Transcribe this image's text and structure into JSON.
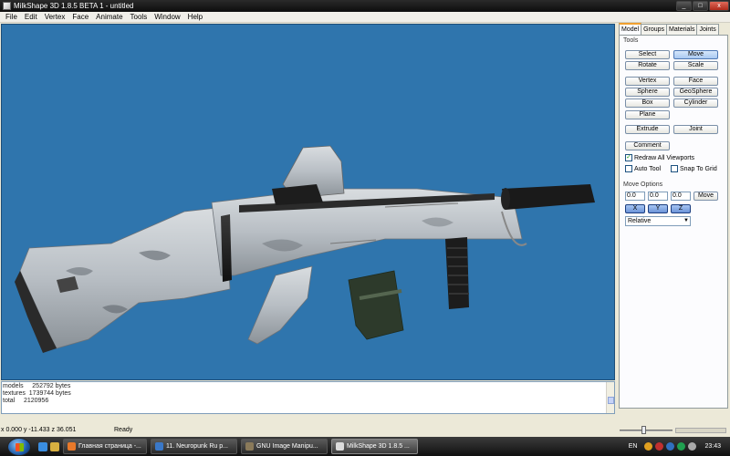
{
  "window": {
    "title": "MilkShape 3D 1.8.5 BETA 1 - untitled",
    "buttons": {
      "minimize": "_",
      "maximize": "□",
      "close": "x"
    }
  },
  "menu": [
    "File",
    "Edit",
    "Vertex",
    "Face",
    "Animate",
    "Tools",
    "Window",
    "Help"
  ],
  "viewport": {
    "background": "#2f75ad"
  },
  "panel": {
    "tabs": [
      "Model",
      "Groups",
      "Materials",
      "Joints"
    ],
    "active_tab": "Model",
    "tools_label": "Tools",
    "tool_buttons": [
      {
        "label": "Select",
        "selected": false
      },
      {
        "label": "Move",
        "selected": true
      },
      {
        "label": "Rotate",
        "selected": false
      },
      {
        "label": "Scale",
        "selected": false
      },
      {
        "label": "Vertex",
        "selected": false
      },
      {
        "label": "Face",
        "selected": false
      },
      {
        "label": "Sphere",
        "selected": false
      },
      {
        "label": "GeoSphere",
        "selected": false
      },
      {
        "label": "Box",
        "selected": false
      },
      {
        "label": "Cylinder",
        "selected": false
      },
      {
        "label": "Plane",
        "selected": false
      },
      {
        "label": "Extrude",
        "selected": false
      },
      {
        "label": "Joint",
        "selected": false
      }
    ],
    "comment_button": "Comment",
    "redraw_all_viewports": {
      "label": "Redraw All Viewports",
      "checked": true
    },
    "auto_tool": {
      "label": "Auto Tool",
      "checked": false
    },
    "snap_to_grid": {
      "label": "Snap To Grid",
      "checked": false
    },
    "move_options_label": "Move Options",
    "move_values": [
      "0.0",
      "0.0",
      "0.0"
    ],
    "move_button": "Move",
    "axis_buttons": [
      "X",
      "Y",
      "Z"
    ],
    "mode_select": "Relative"
  },
  "log": {
    "lines": [
      "models     252792 bytes",
      "textures  1739744 bytes",
      "total     2120956"
    ]
  },
  "status": {
    "coords": "x 0.000 y -11.433 z 36.051",
    "state": "Ready"
  },
  "taskbar": {
    "tasks": [
      {
        "label": "Главная страница -...",
        "icon_color": "#e8792a",
        "active": false
      },
      {
        "label": "11. Neuropunk Ru p...",
        "icon_color": "#3a78c8",
        "active": false
      },
      {
        "label": "GNU Image Manipu...",
        "icon_color": "#8a7a5a",
        "active": false
      },
      {
        "label": "MilkShape 3D 1.8.5 ...",
        "icon_color": "#dcdcdc",
        "active": true
      }
    ],
    "language": "EN",
    "clock": "23:43"
  }
}
